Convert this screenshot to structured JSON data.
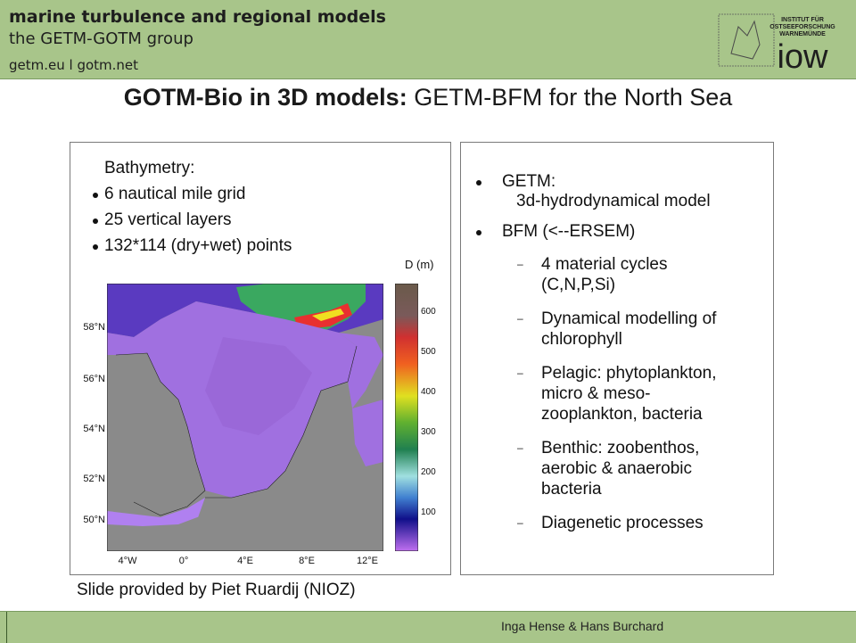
{
  "header": {
    "title": "marine turbulence and regional models",
    "subtitle": "the GETM-GOTM group",
    "links": "getm.eu  l  gotm.net",
    "logo_text_line1": "INSTITUT FÜR",
    "logo_text_line2": "OSTSEEFORSCHUNG",
    "logo_text_line3": "WARNEMÜNDE",
    "logo_word": "iow"
  },
  "slide": {
    "title_bold": "GOTM-Bio in 3D models:",
    "title_rest": " GETM-BFM for the North Sea"
  },
  "left_panel": {
    "bathymetry_heading": "Bathymetry:",
    "bullets": [
      "6 nautical mile grid",
      "25 vertical layers",
      "132*114 (dry+wet) points"
    ],
    "colorbar_label": "D (m)",
    "colorbar_ticks": [
      "600",
      "500",
      "400",
      "300",
      "200",
      "100"
    ],
    "lat_labels": [
      "58°N",
      "56°N",
      "54°N",
      "52°N",
      "50°N"
    ],
    "lon_labels": [
      "4°W",
      "0°",
      "4°E",
      "8°E",
      "12°E"
    ]
  },
  "caption": "Slide provided by Piet Ruardij (NIOZ)",
  "right_panel": {
    "items": [
      {
        "line1": "GETM:",
        "line2": "3d-hydrodynamical model"
      },
      {
        "line1": "BFM  (<--ERSEM)",
        "line2": ""
      }
    ],
    "subitems": [
      [
        "4 material cycles",
        "(C,N,P,Si)"
      ],
      [
        "Dynamical modelling of",
        "chlorophyll"
      ],
      [
        "Pelagic: phytoplankton,",
        "micro & meso-",
        "zooplankton, bacteria"
      ],
      [
        "Benthic: zoobenthos,",
        "aerobic & anaerobic",
        "bacteria"
      ],
      [
        "Diagenetic processes"
      ]
    ]
  },
  "footer": {
    "authors": "Inga Hense & Hans Burchard"
  },
  "colors": {
    "header_bg": "#a8c58a",
    "land": "#8a8a8a",
    "shallow_sea": "#a070e0",
    "deep_sea": "#5a3ac0"
  }
}
